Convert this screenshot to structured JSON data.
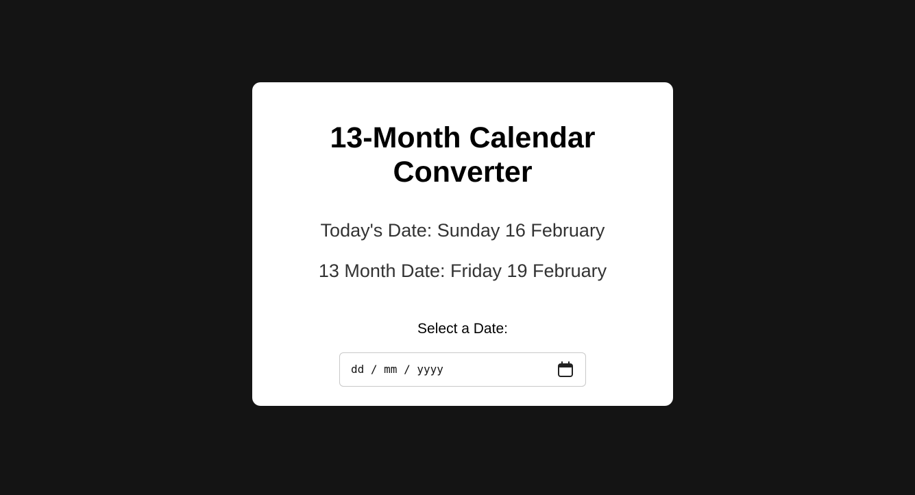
{
  "converter": {
    "title": "13-Month Calendar Converter",
    "todays_date": "Today's Date: Sunday 16 February",
    "thirteen_month_date": "13 Month Date: Friday 19 February",
    "select_label": "Select a Date:",
    "date_input": {
      "placeholder": "dd / mm / yyyy",
      "value": "",
      "icon": "calendar-icon"
    }
  },
  "colors": {
    "page_background": "#141414",
    "card_background": "#ffffff",
    "text_primary": "#000000",
    "text_secondary": "#333333",
    "input_border": "#c8c8c8"
  }
}
